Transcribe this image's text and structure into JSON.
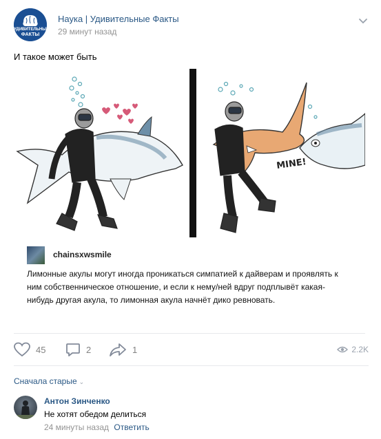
{
  "post": {
    "group_name": "Наука | Удивительные Факты",
    "time": "29 минут назад",
    "avatar_text": [
      "УДИВИТЕЛЬНЫЕ",
      "ФАКТЫ"
    ],
    "text": "И такое может быть"
  },
  "comic": {
    "right_panel_word": "MINE!"
  },
  "quote": {
    "username": "chainsxwsmile",
    "text": "Лимонные акулы могут иногда проникаться симпатией к дайверам и проявлять к ним собственническое отношение, и если к нему/ней вдруг подплывёт какая-нибудь другая акула, то лимонная акула начнёт дико ревновать."
  },
  "actions": {
    "likes": "45",
    "comments": "2",
    "shares": "1",
    "views": "2.2K"
  },
  "comments_section": {
    "sort_label": "Сначала старые",
    "items": [
      {
        "author": "Антон Зинченко",
        "text": "Не хотят обедом делиться",
        "time": "24 минуты назад",
        "reply_label": "Ответить"
      }
    ]
  },
  "colors": {
    "link": "#2a5885",
    "muted": "#939393",
    "avatar_bg": "#1b4f93"
  },
  "icons": [
    "vk-group-logo",
    "chevron-down-icon",
    "heart-icon",
    "comment-icon",
    "share-icon",
    "eye-icon"
  ]
}
